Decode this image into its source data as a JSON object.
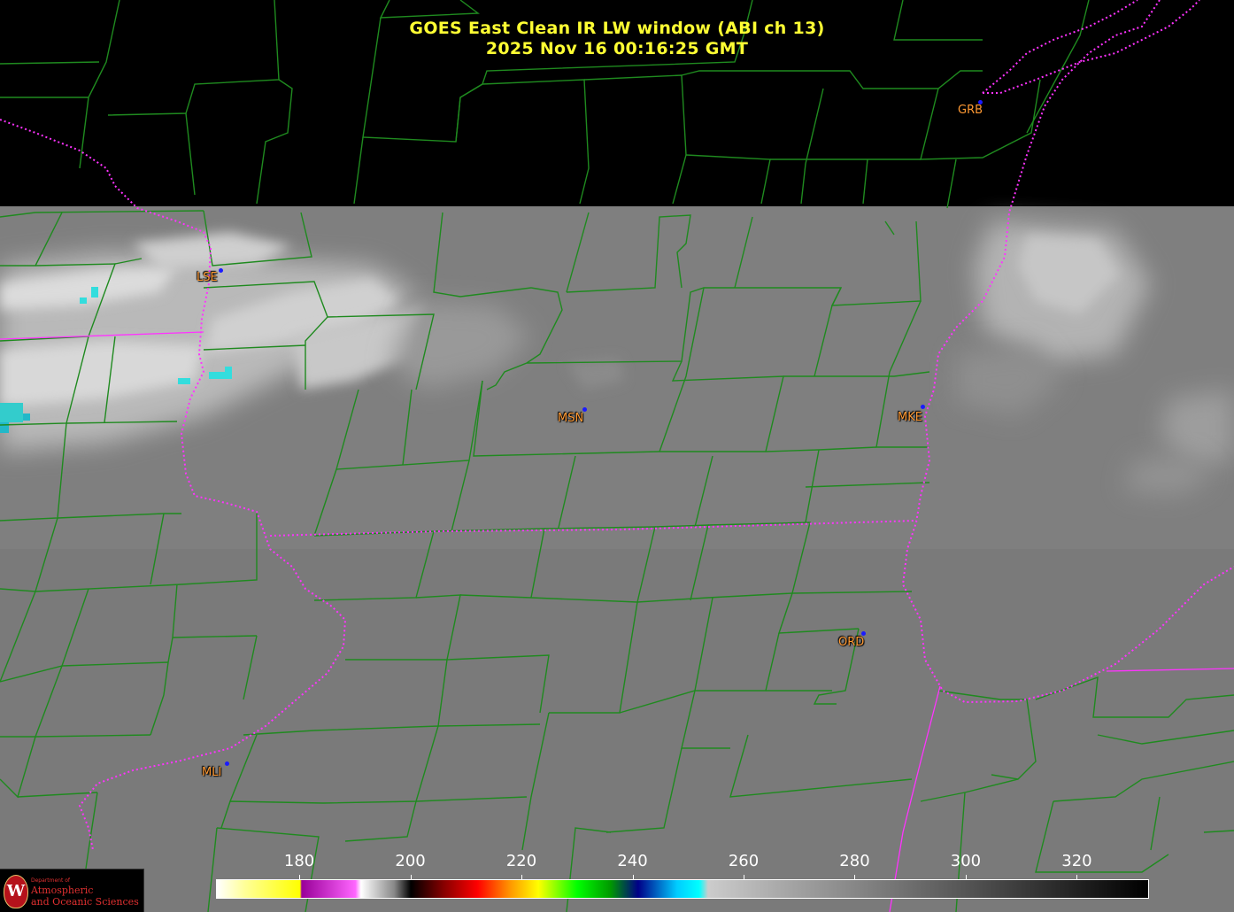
{
  "header": {
    "title_line1": "GOES East Clean IR LW window (ABI ch 13)",
    "title_line2": "2025 Nov 16  00:16:25 GMT"
  },
  "stations": [
    {
      "id": "GRB",
      "label": "GRB"
    },
    {
      "id": "LSE",
      "label": "LSE"
    },
    {
      "id": "MSN",
      "label": "MSN"
    },
    {
      "id": "MKE",
      "label": "MKE"
    },
    {
      "id": "ORD",
      "label": "ORD"
    },
    {
      "id": "MLI",
      "label": "MLI"
    }
  ],
  "colorbar": {
    "ticks": [
      "180",
      "200",
      "220",
      "240",
      "260",
      "280",
      "300",
      "320"
    ],
    "range": [
      165,
      333
    ]
  },
  "logo": {
    "dept": "Department of",
    "name_line1": "Atmospheric",
    "name_line2": "and Oceanic Sciences",
    "crest": "W"
  },
  "colors": {
    "title": "#ffff33",
    "county_lines": "#1f8a1f",
    "state_lines": "#ff33ff",
    "station_label": "#ff9933",
    "station_dot": "#1a1aff",
    "ir_background": "#7f7f7f"
  }
}
